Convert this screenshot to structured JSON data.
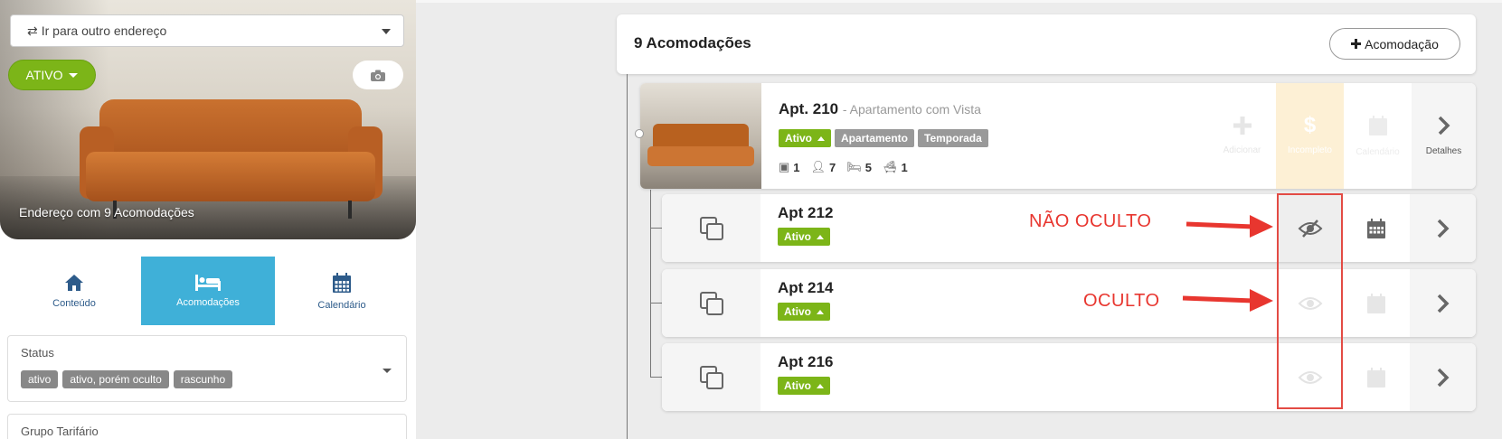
{
  "sidebar": {
    "address_select": {
      "label": "Ir para outro endereço",
      "icon": "exchange-icon"
    },
    "status_button": "ATIVO",
    "camera_icon": "camera-icon",
    "hero_caption": "Endereço com 9 Acomodações",
    "tabs": [
      {
        "label": "Conteúdo",
        "icon": "home-icon",
        "active": false
      },
      {
        "label": "Acomodações",
        "icon": "bed-icon",
        "active": true
      },
      {
        "label": "Calendário",
        "icon": "calendar-icon",
        "active": false
      }
    ],
    "status_filter": {
      "label": "Status",
      "chips": [
        "ativo",
        "ativo, porém oculto",
        "rascunho"
      ]
    },
    "group_filter": {
      "label": "Grupo Tarifário"
    }
  },
  "main": {
    "title": "9 Acomodações",
    "add_button": "Acomodação",
    "parent": {
      "name": "Apt. 210",
      "subtitle": "- Apartamento com Vista",
      "badges": [
        "Ativo",
        "Apartamento",
        "Temporada"
      ],
      "stats": {
        "rooms": "1",
        "guests": "7",
        "beds": "5",
        "baths": "1"
      },
      "actions": {
        "add": "Adicionar",
        "incomplete": "Incompleto",
        "calendar": "Calendário",
        "details": "Detalhes"
      }
    },
    "children": [
      {
        "name": "Apt 212",
        "badge": "Ativo",
        "visibility": "visible"
      },
      {
        "name": "Apt 214",
        "badge": "Ativo",
        "visibility": "hidden"
      },
      {
        "name": "Apt 216",
        "badge": "Ativo",
        "visibility": "hidden"
      }
    ]
  },
  "annotations": {
    "not_hidden": "NÃO OCULTO",
    "hidden": "OCULTO",
    "color": "#e8362f"
  },
  "colors": {
    "green": "#7cb518",
    "accent": "#3fb0d8",
    "incomplete": "#fdf0d5"
  }
}
